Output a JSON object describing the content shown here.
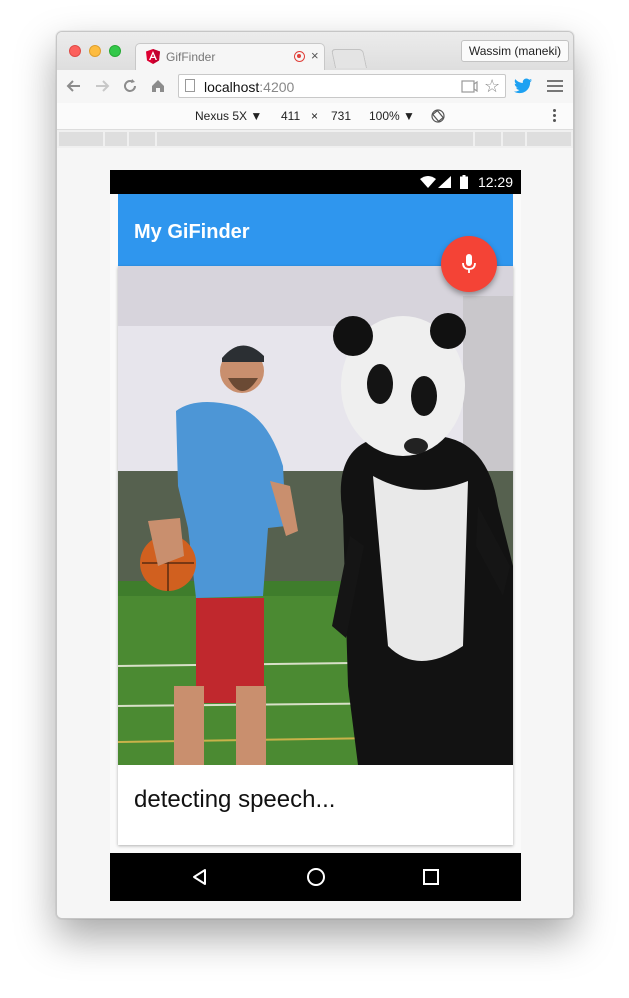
{
  "browser": {
    "tab_title": "GifFinder",
    "tab_close": "×",
    "profile_name": "Wassim (maneki)",
    "url_host": "localhost",
    "url_port": ":4200",
    "icons": [
      "back-arrow-icon",
      "forward-arrow-icon",
      "reload-icon",
      "home-icon",
      "page-icon",
      "cast-icon",
      "star-icon",
      "twitter-icon",
      "menu-icon"
    ]
  },
  "devtools": {
    "device": "Nexus 5X ▼",
    "width": "411",
    "times": "×",
    "height": "731",
    "zoom": "100% ▼"
  },
  "phone": {
    "time": "12:29",
    "app_title": "My GiFinder",
    "caption": "detecting speech..."
  },
  "colors": {
    "app_bar": "#2f96ee",
    "fab": "#f44336"
  }
}
